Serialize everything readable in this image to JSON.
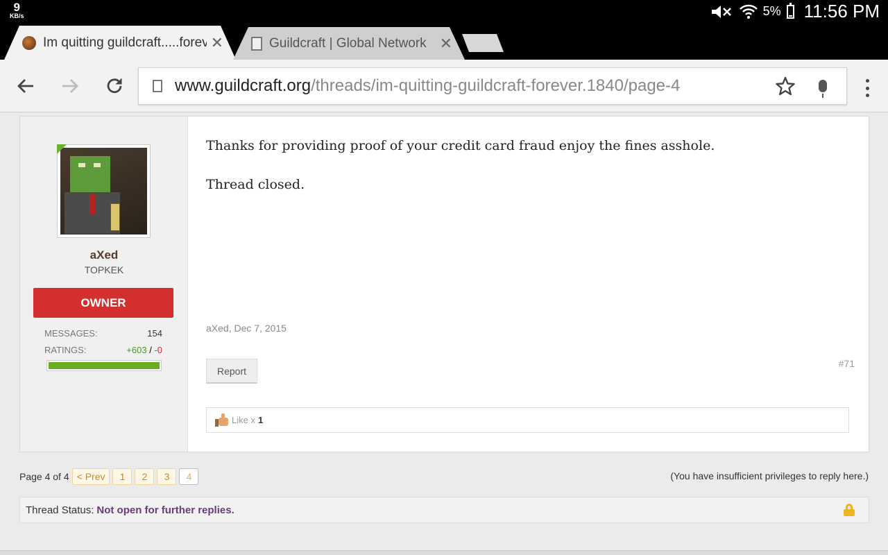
{
  "status_bar": {
    "net_speed": "9",
    "net_unit": "KB/s",
    "battery_pct": "5%",
    "time": "11:56 PM",
    "icons": [
      "mute-icon",
      "wifi-icon",
      "battery-icon"
    ]
  },
  "tabs": [
    {
      "title": "Im quitting guildcraft.....forever",
      "favicon": "orc-favicon-icon",
      "active": true
    },
    {
      "title": "Guildcraft | Global Network",
      "favicon": "page-icon",
      "active": false
    }
  ],
  "toolbar": {
    "url_domain": "www.guildcraft.org",
    "url_path": "/threads/im-quitting-guildcraft-forever.1840/page-4",
    "icons": [
      "back-icon",
      "forward-icon",
      "reload-icon",
      "star-icon",
      "mic-icon",
      "menu-icon"
    ]
  },
  "post": {
    "username": "aXed",
    "user_title": "TOPKEK",
    "rank": "OWNER",
    "rank_color": "#d32f2f",
    "messages_label": "MESSAGES:",
    "messages_value": "154",
    "ratings_label": "RATINGS:",
    "ratings_positive": "+603",
    "ratings_sep": "/",
    "ratings_negative": "-0",
    "rating_fill_fraction": 1.0,
    "body": [
      "Thanks for providing proof of your credit card fraud enjoy the fines asshole.",
      "Thread closed."
    ],
    "meta": "aXed, Dec 7, 2015",
    "report_label": "Report",
    "post_number": "#71",
    "like_label": "Like x",
    "like_count": "1"
  },
  "pagenav": {
    "label": "Page 4 of 4",
    "prev": "< Prev",
    "pages": [
      "1",
      "2",
      "3",
      "4"
    ],
    "current": "4"
  },
  "reply_notice": "(You have insufficient privileges to reply here.)",
  "thread_status": {
    "label": "Thread Status:",
    "value": "Not open for further replies."
  }
}
